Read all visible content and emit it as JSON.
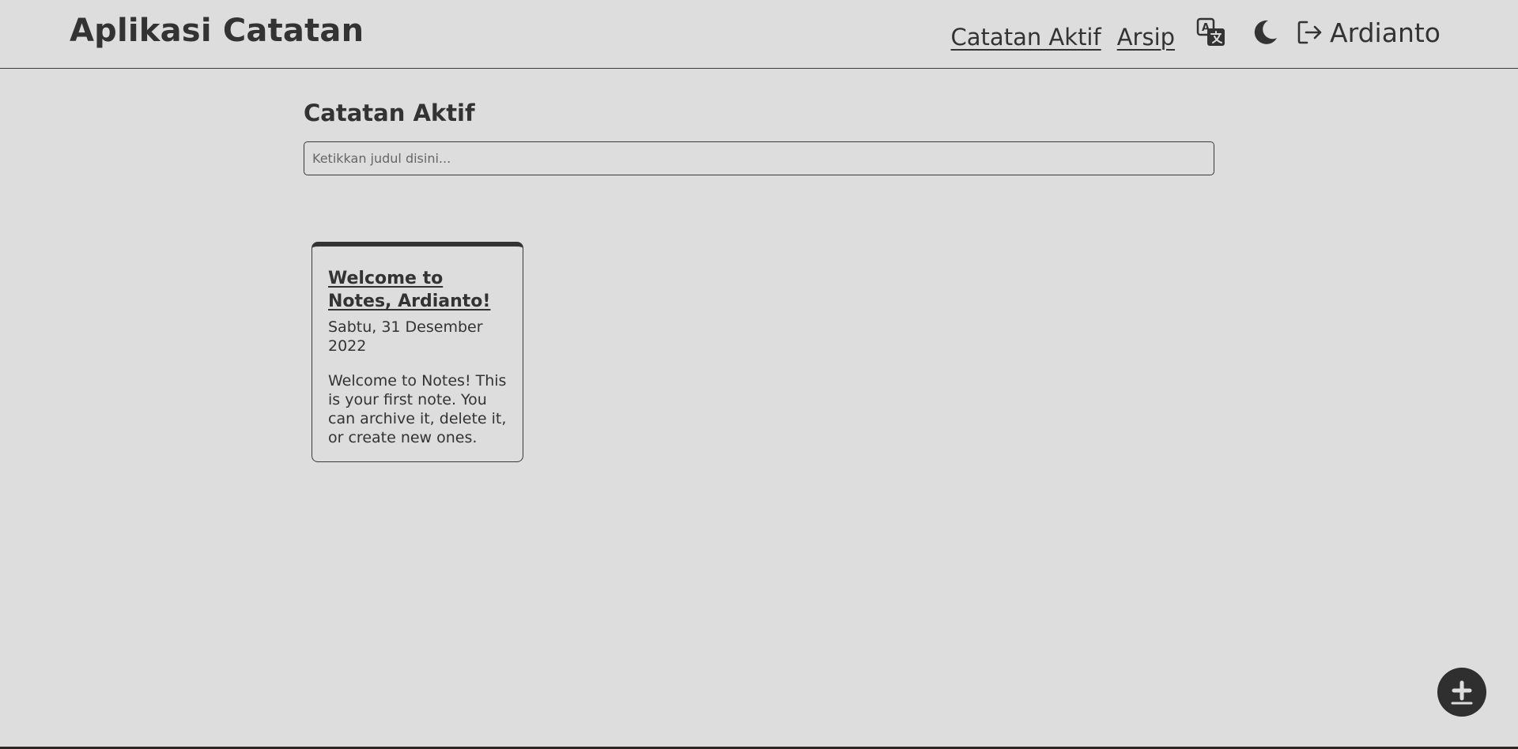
{
  "header": {
    "brand": "Aplikasi Catatan",
    "nav": {
      "active_notes": "Catatan Aktif",
      "archive": "Arsip"
    },
    "user": {
      "name": "Ardianto"
    },
    "icons": [
      "translate-icon",
      "moon-icon",
      "logout-icon"
    ]
  },
  "main": {
    "title": "Catatan Aktif",
    "search": {
      "value": "",
      "placeholder": "Ketikkan judul disini..."
    },
    "notes": [
      {
        "title": "Welcome to Notes, Ardianto!",
        "date": "Sabtu, 31 Desember 2022",
        "body": "Welcome to Notes! This is your first note. You can archive it, delete it, or create new ones."
      }
    ]
  },
  "fab": {
    "icon": "add-icon"
  },
  "colors": {
    "background": "#dddddd",
    "text": "#333333",
    "accent": "#2f2f2f"
  }
}
